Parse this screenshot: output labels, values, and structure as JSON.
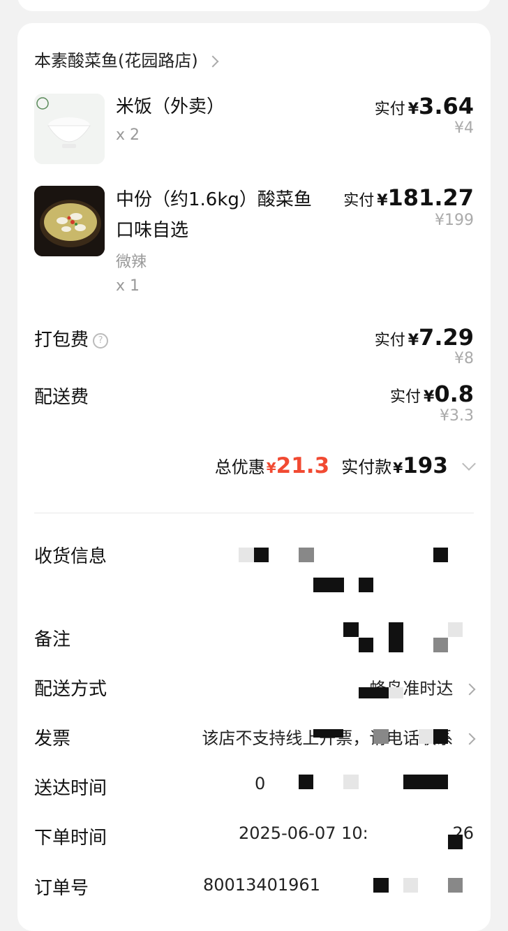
{
  "shop": {
    "name": "本素酸菜鱼(花园路店)"
  },
  "items": [
    {
      "name": "米饭（外卖）",
      "qty": "x 2",
      "pay_label": "实付",
      "currency": "¥",
      "pay_value": "3.64",
      "original": "¥4"
    },
    {
      "name_line1": "中份（约1.6kg）酸菜鱼",
      "name_line2": "口味自选",
      "spec": "微辣",
      "qty": "x 1",
      "pay_label": "实付",
      "currency": "¥",
      "pay_value": "181.27",
      "original": "¥199"
    }
  ],
  "packing_fee": {
    "label": "打包费",
    "pay_label": "实付",
    "currency": "¥",
    "pay_value": "7.29",
    "original": "¥8"
  },
  "delivery_fee": {
    "label": "配送费",
    "pay_label": "实付",
    "currency": "¥",
    "pay_value": "0.8",
    "original": "¥3.3"
  },
  "summary": {
    "discount_label": "总优惠",
    "discount_currency": "¥",
    "discount_value": "21.3",
    "paid_label": "实付款",
    "paid_currency": "¥",
    "paid_value": "193"
  },
  "info": {
    "address_label": "收货信息",
    "note_label": "备注",
    "delivery_method_label": "配送方式",
    "delivery_method_value": "蜂鸟准时达",
    "invoice_label": "发票",
    "invoice_value": "该店不支持线上开票，请电话联系",
    "arrival_label": "送达时间",
    "arrival_value": "0",
    "order_time_label": "下单时间",
    "order_time_value": "2025-06-07 10:",
    "order_time_tail": "26",
    "order_no_label": "订单号",
    "order_no_value": "80013401961"
  },
  "colors": {
    "accent_red": "#f14a32"
  }
}
